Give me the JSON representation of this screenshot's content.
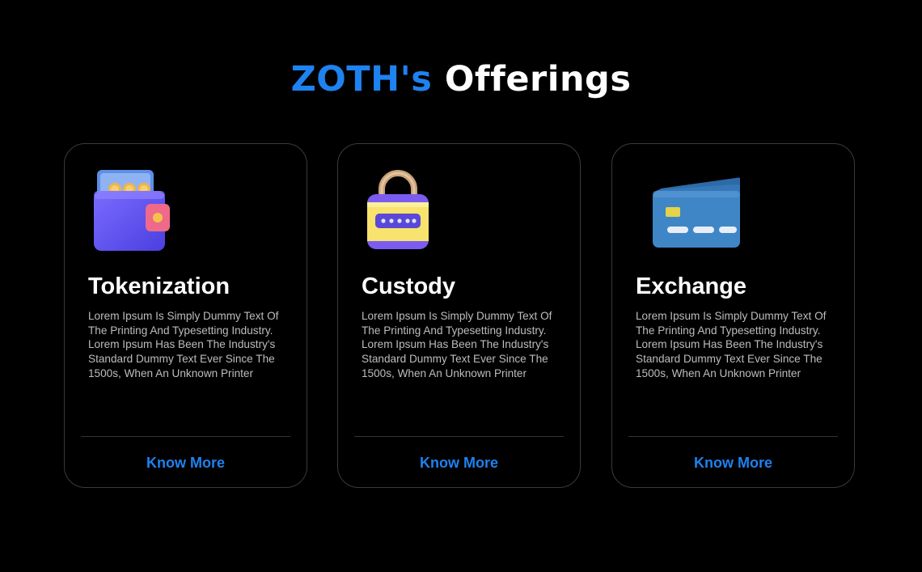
{
  "heading": {
    "brand": "ZOTH's",
    "rest": "Offerings"
  },
  "cards": [
    {
      "title": "Tokenization",
      "description": "Lorem Ipsum Is Simply Dummy Text Of The Printing And Typesetting Industry. Lorem Ipsum Has Been The Industry's Standard Dummy Text Ever Since The 1500s, When An Unknown Printer",
      "cta": "Know More",
      "icon": "wallet-icon"
    },
    {
      "title": "Custody",
      "description": "Lorem Ipsum Is Simply Dummy Text Of The Printing And Typesetting Industry. Lorem Ipsum Has Been The Industry's Standard Dummy Text Ever Since The 1500s, When An Unknown Printer",
      "cta": "Know More",
      "icon": "padlock-icon"
    },
    {
      "title": "Exchange",
      "description": "Lorem Ipsum Is Simply Dummy Text Of The Printing And Typesetting Industry. Lorem Ipsum Has Been The Industry's Standard Dummy Text Ever Since The 1500s, When An Unknown Printer",
      "cta": "Know More",
      "icon": "credit-card-icon"
    }
  ],
  "colors": {
    "accent": "#1e82f0",
    "background": "#000000",
    "card_border": "#3a3a3a"
  }
}
